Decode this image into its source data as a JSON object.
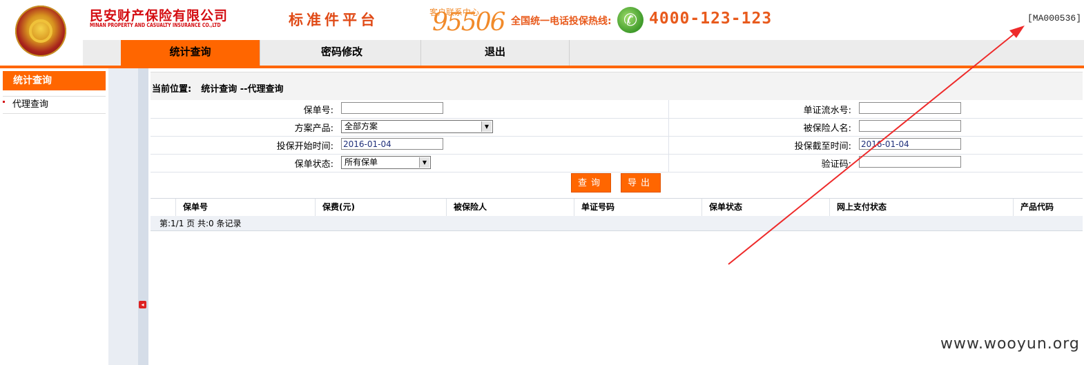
{
  "header": {
    "company_name": "民安财产保险有限公司",
    "company_name_en": "MINAN PROPERTY AND CASUALTY INSURANCE CO.,LTD",
    "platform_title": "标准件平台",
    "service_center": "客户联系中心",
    "service_number": "95506",
    "hotline_label": "全国统一电话投保热线:",
    "hotline_number": "4000-123-123",
    "account_id": "[MA000536]"
  },
  "nav": {
    "tabs": [
      {
        "label": "统计查询",
        "active": true
      },
      {
        "label": "密码修改",
        "active": false
      },
      {
        "label": "退出",
        "active": false
      }
    ]
  },
  "sidebar": {
    "heading": "统计查询",
    "items": [
      {
        "label": "代理查询"
      }
    ]
  },
  "breadcrumb": {
    "prefix": "当前位置:",
    "path": "统计查询 --代理查询"
  },
  "form": {
    "policy_no_label": "保单号:",
    "policy_no_value": "",
    "voucher_serial_label": "单证流水号:",
    "voucher_serial_value": "",
    "product_label": "方案产品:",
    "product_value": "全部方案",
    "insured_name_label": "被保险人名:",
    "insured_name_value": "",
    "start_date_label": "投保开始时间:",
    "start_date_value": "2016-01-04",
    "end_date_label": "投保截至时间:",
    "end_date_value": "2016-01-04",
    "status_label": "保单状态:",
    "status_value": "所有保单",
    "captcha_label": "验证码:",
    "captcha_value": ""
  },
  "buttons": {
    "query": "查询",
    "export": "导出"
  },
  "grid": {
    "columns": [
      "保单号",
      "保费(元)",
      "被保险人",
      "单证号码",
      "保单状态",
      "网上支付状态",
      "产品代码"
    ],
    "pager": "第:1/1 页 共:0 条记录"
  },
  "watermark": "www.wooyun.org",
  "colors": {
    "accent": "#ff6600",
    "brand_red": "#d40d12",
    "annotation_arrow": "#ee2a2a"
  }
}
